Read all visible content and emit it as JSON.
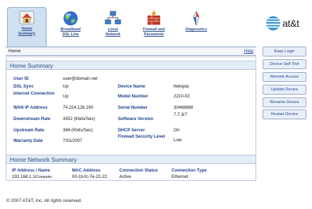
{
  "nav": {
    "tabs": [
      {
        "label_line1": "Home",
        "label_line2": "Summary",
        "icon": "house-icon",
        "active": true
      },
      {
        "label_line1": "Broadband",
        "label_line2": "DSL Line",
        "icon": "globe-icon",
        "active": false
      },
      {
        "label_line1": "Local",
        "label_line2": "Network",
        "icon": "network-icon",
        "active": false
      },
      {
        "label_line1": "Firewall and",
        "label_line2": "Passwords",
        "icon": "firewall-icon",
        "active": false
      },
      {
        "label_line1": "Diagnostics",
        "label_line2": "",
        "icon": "diagnostics-icon",
        "active": false
      }
    ],
    "brand": "at&t"
  },
  "breadcrumb": {
    "current": "Home",
    "help": "Help"
  },
  "home_summary": {
    "title": "Home Summary",
    "left": [
      {
        "label": "User ID",
        "value": "user@domain.net"
      },
      {
        "label": "DSL Sync",
        "value": "Up"
      },
      {
        "label": "Internet Connection",
        "value": "Up"
      },
      {
        "label": "WAN IP Address",
        "value": "74.224.126.190"
      },
      {
        "label": "Downstream Rate",
        "value": "3552 (Kbits/Sec)"
      },
      {
        "label": "Upstream Rate",
        "value": "384 (Kbits/Sec)"
      },
      {
        "label": "Warranty Date",
        "value": "7/31/2007"
      }
    ],
    "right": [
      {
        "label": "Device Name",
        "value": "Netopia"
      },
      {
        "label": "Model Number",
        "value": "2210-02"
      },
      {
        "label": "Serial Number",
        "value": "30468668"
      },
      {
        "label": "Software Version",
        "value": "7.7.3r7"
      },
      {
        "label": "DHCP Server",
        "value": "On"
      },
      {
        "label": "Firewall Security Level",
        "value": "Low"
      }
    ]
  },
  "home_network": {
    "title": "Home Network Summary",
    "columns": [
      "IP Address / Name",
      "MAC Address",
      "Connection Status",
      "Connection Type"
    ],
    "rows": [
      {
        "ip": "192.168.1.1/",
        "name": "Computer",
        "mac": "00-1b-fc-7e-22-22",
        "status": "Active",
        "type": "Ethernet"
      }
    ]
  },
  "side_buttons": [
    "Easy Login",
    "Device Self Test",
    "Remote Access",
    "Update Device",
    "Rename Device",
    "Restart Device"
  ],
  "footer": "© 2007 AT&T, Inc. All rights reserved."
}
